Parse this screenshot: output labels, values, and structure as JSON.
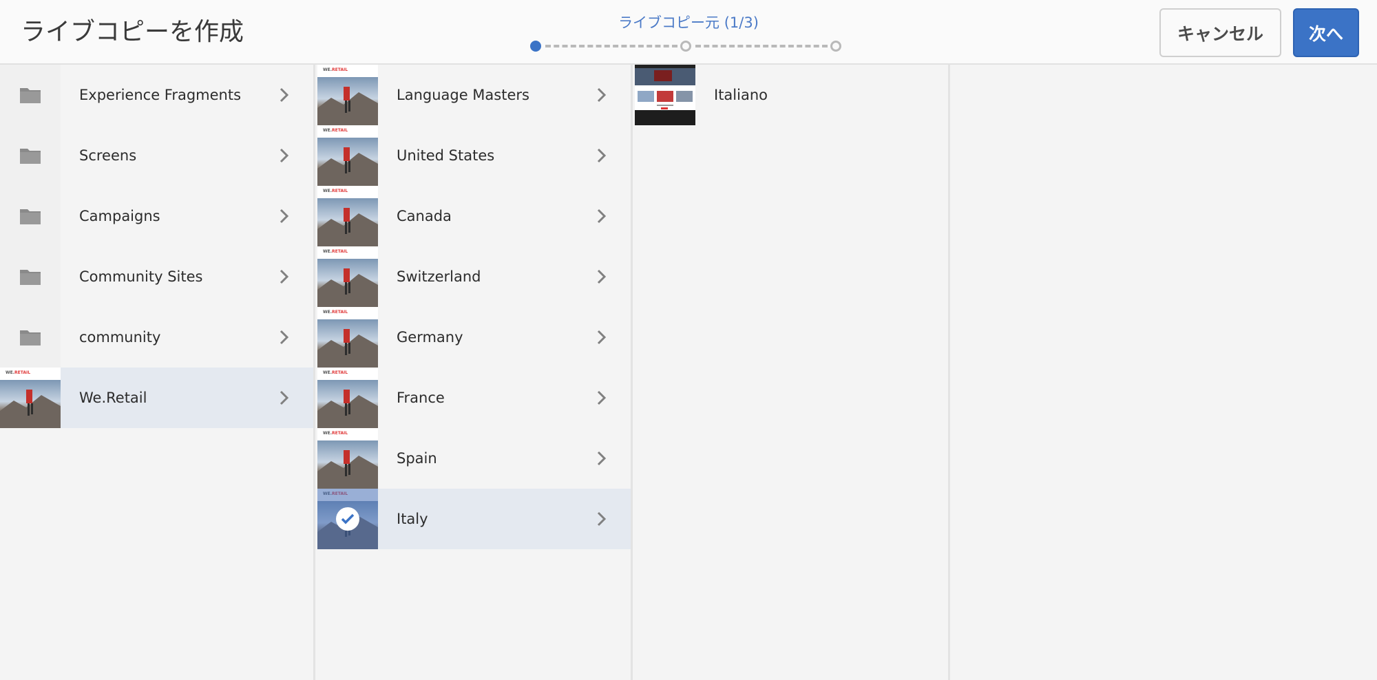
{
  "header": {
    "title": "ライブコピーを作成",
    "wizard_label": "ライブコピー元 (1/3)",
    "cancel_label": "キャンセル",
    "next_label": "次へ"
  },
  "colors": {
    "accent": "#3b73c6",
    "selected_row": "#e4e9f0"
  },
  "columns": [
    {
      "items": [
        {
          "label": "Experience Fragments",
          "icon": "folder-icon"
        },
        {
          "label": "Screens",
          "icon": "folder-icon"
        },
        {
          "label": "Campaigns",
          "icon": "folder-icon"
        },
        {
          "label": "Community Sites",
          "icon": "folder-icon"
        },
        {
          "label": "community",
          "icon": "folder-icon"
        },
        {
          "label": "We.Retail",
          "icon": "page-thumbnail"
        }
      ]
    },
    {
      "items": [
        {
          "label": "Language Masters"
        },
        {
          "label": "United States"
        },
        {
          "label": "Canada"
        },
        {
          "label": "Switzerland"
        },
        {
          "label": "Germany"
        },
        {
          "label": "France"
        },
        {
          "label": "Spain"
        },
        {
          "label": "Italy"
        }
      ]
    },
    {
      "items": [
        {
          "label": "Italiano"
        }
      ]
    }
  ],
  "thumbnail_brand": {
    "prefix": "WE.",
    "name": "RETAIL"
  }
}
